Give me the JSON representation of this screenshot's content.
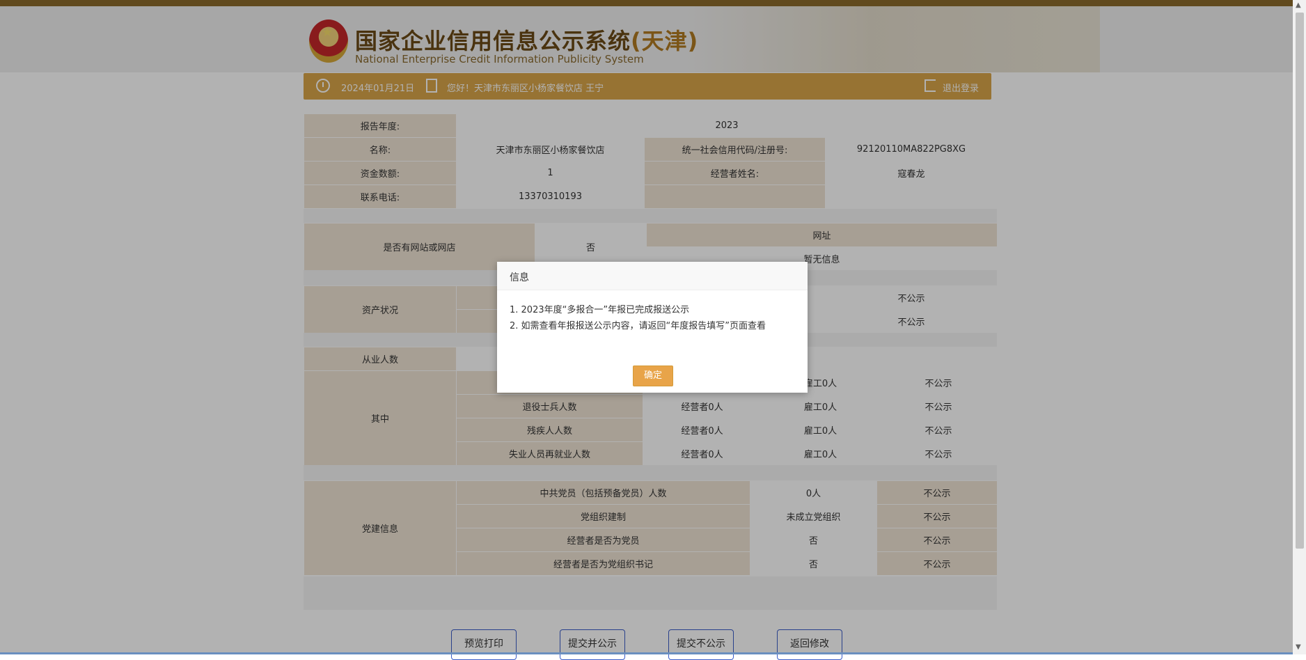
{
  "header": {
    "title": "国家企业信用信息公示系统",
    "region": "(天津)",
    "subtitle": "National Enterprise Credit Information Publicity System"
  },
  "userbar": {
    "date": "2024年01月21日",
    "greeting": "您好！天津市东丽区小杨家餐饮店   王宁",
    "logout": "退出登录"
  },
  "basic": {
    "year_label": "报告年度:",
    "year": "2023",
    "name_label": "名称:",
    "name": "天津市东丽区小杨家餐饮店",
    "code_label": "统一社会信用代码/注册号:",
    "code": "92120110MA822PG8XG",
    "capital_label": "资金数额:",
    "capital": "1",
    "operator_label": "经营者姓名:",
    "operator": "寇春龙",
    "phone_label": "联系电话:",
    "phone": "13370310193"
  },
  "website": {
    "label": "是否有网站或网店",
    "value": "否",
    "url_header": "网址",
    "url_value": "暂无信息"
  },
  "assets": {
    "label": "资产状况",
    "row1": "不公示",
    "row2": "不公示"
  },
  "employees": {
    "label": "从业人数",
    "group_label": "其中",
    "rows": [
      {
        "name": "",
        "operator": "",
        "employee": "雇工0人",
        "public": "不公示"
      },
      {
        "name": "退役士兵人数",
        "operator": "经营者0人",
        "employee": "雇工0人",
        "public": "不公示"
      },
      {
        "name": "残疾人人数",
        "operator": "经营者0人",
        "employee": "雇工0人",
        "public": "不公示"
      },
      {
        "name": "失业人员再就业人数",
        "operator": "经营者0人",
        "employee": "雇工0人",
        "public": "不公示"
      }
    ]
  },
  "party": {
    "label": "党建信息",
    "rows": [
      {
        "name": "中共党员（包括预备党员）人数",
        "value": "0人",
        "public": "不公示"
      },
      {
        "name": "党组织建制",
        "value": "未成立党组织",
        "public": "不公示"
      },
      {
        "name": "经营者是否为党员",
        "value": "否",
        "public": "不公示"
      },
      {
        "name": "经营者是否为党组织书记",
        "value": "否",
        "public": "不公示"
      }
    ]
  },
  "dialog": {
    "title": "信息",
    "line1": "1.  2023年度“多报合一”年报已完成报送公示",
    "line2": "2.  如需查看年报报送公示内容，请返回“年度报告填写”页面查看",
    "ok": "确定"
  },
  "buttons": {
    "preview": "预览打印",
    "submit_public": "提交并公示",
    "submit_nopublic": "提交不公示",
    "back": "返回修改"
  }
}
